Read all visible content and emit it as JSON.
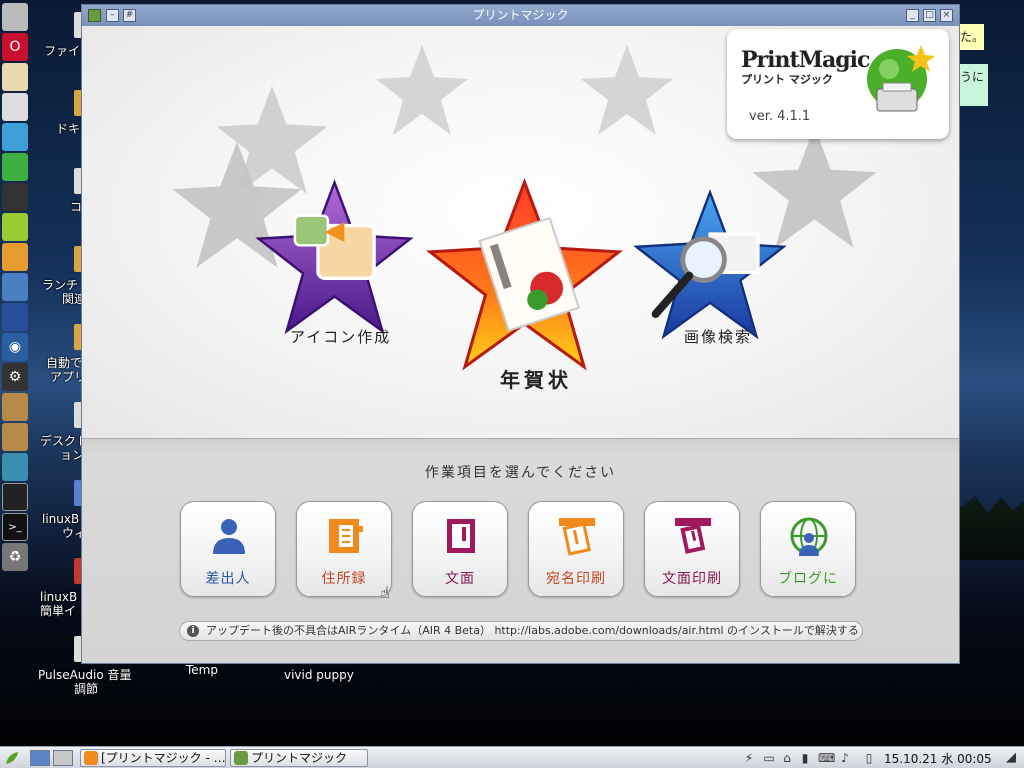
{
  "window": {
    "title": "プリントマジック"
  },
  "logo": {
    "main": "PrintMagic",
    "sub": "プリント マジック",
    "version": "ver. 4.1.1"
  },
  "hero": {
    "left_label": "アイコン作成",
    "center_label": "年賀状",
    "right_label": "画像検索"
  },
  "panel": {
    "prompt": "作業項目を選んでください",
    "buttons": [
      {
        "label": "差出人",
        "color": "#2b57a8"
      },
      {
        "label": "住所録",
        "color": "#c4461c"
      },
      {
        "label": "文面",
        "color": "#8b1550"
      },
      {
        "label": "宛名印刷",
        "color": "#c4461c"
      },
      {
        "label": "文面印刷",
        "color": "#8b1550"
      },
      {
        "label": "ブログに",
        "color": "#3b9a2a"
      }
    ],
    "info": "アップデート後の不具合はAIRランタイム（AIR 4 Beta） http://labs.adobe.com/downloads/air.html のインストールで解決する"
  },
  "desktop": {
    "labels": [
      "ファイル",
      "ドキ",
      "コ",
      "ランチ",
      "関連",
      "自動で",
      "アプリ",
      "デスクト",
      "ョン",
      "linuxB",
      "ウィ",
      "linuxB",
      "簡単イ",
      "PulseAudio 音量",
      "調節",
      "Temp",
      "vivid puppy"
    ],
    "notes": [
      "た。",
      "うに"
    ]
  },
  "taskbar": {
    "tasks": [
      "[プリントマジック - …",
      "プリントマジック"
    ],
    "clock": "15.10.21 水 00:05"
  }
}
